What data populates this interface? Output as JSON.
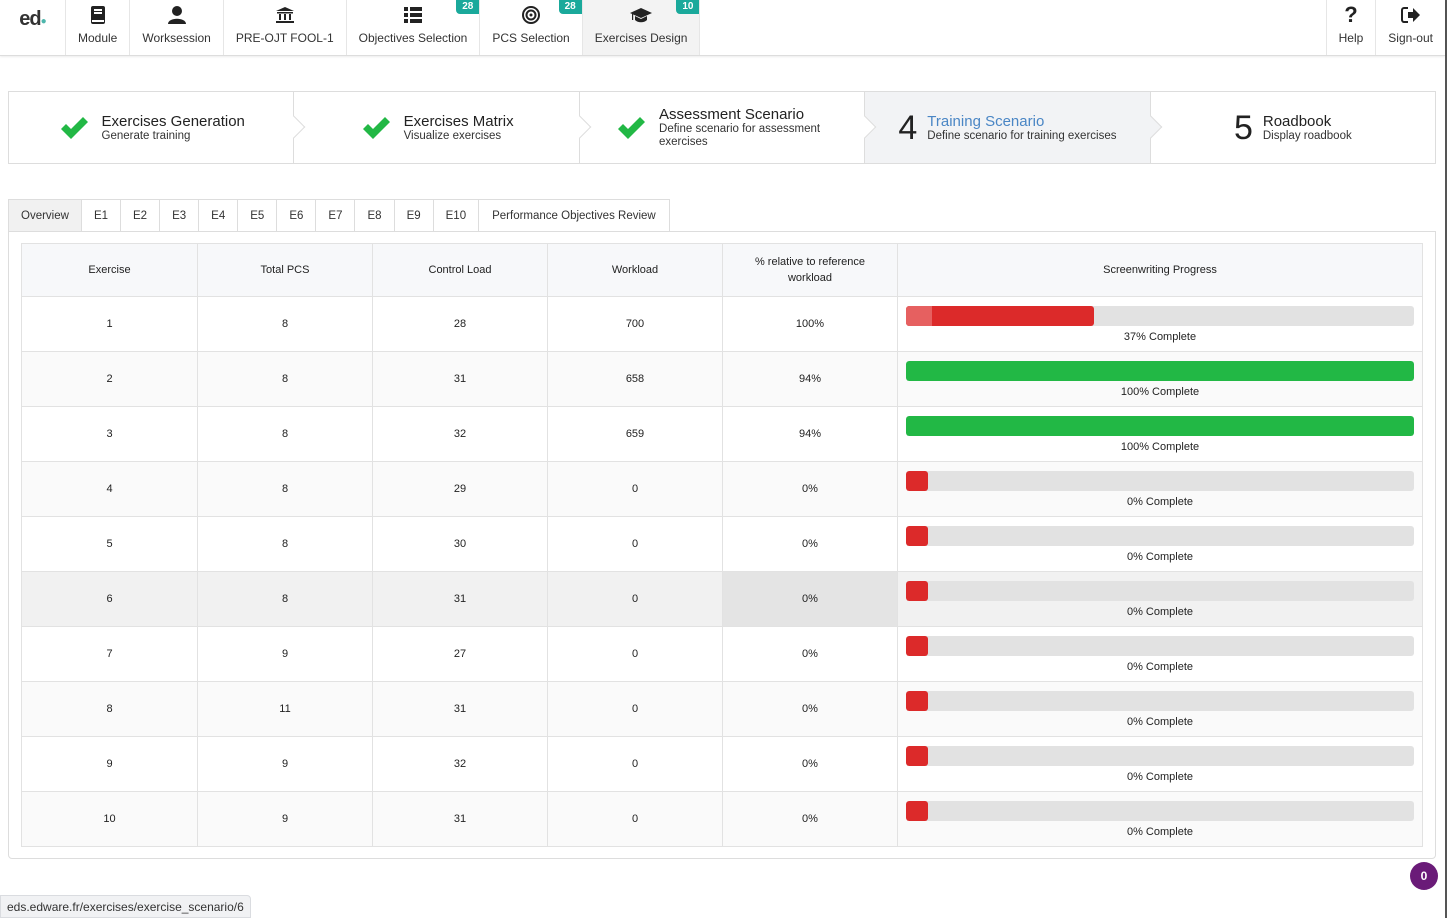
{
  "nav": {
    "logo": "ed",
    "items": [
      {
        "label": "Module",
        "icon": "book-icon"
      },
      {
        "label": "Worksession",
        "icon": "user-icon"
      },
      {
        "label": "PRE-OJT FOOL-1",
        "icon": "institution-icon"
      },
      {
        "label": "Objectives Selection",
        "icon": "list-icon",
        "badge": "28"
      },
      {
        "label": "PCS Selection",
        "icon": "target-icon",
        "badge": "28"
      },
      {
        "label": "Exercises Design",
        "icon": "graduation-cap-icon",
        "badge": "10",
        "active": true
      }
    ],
    "right": [
      {
        "label": "Help",
        "icon": "question-icon"
      },
      {
        "label": "Sign-out",
        "icon": "sign-out-icon"
      }
    ]
  },
  "steps": [
    {
      "title": "Exercises Generation",
      "desc": "Generate training",
      "done": true
    },
    {
      "title": "Exercises Matrix",
      "desc": "Visualize exercises",
      "done": true
    },
    {
      "title": "Assessment Scenario",
      "desc": "Define scenario for assessment exercises",
      "done": true
    },
    {
      "number": "4",
      "title": "Training Scenario",
      "desc": "Define scenario for training exercises",
      "current": true
    },
    {
      "number": "5",
      "title": "Roadbook",
      "desc": "Display roadbook"
    }
  ],
  "tabs": [
    "Overview",
    "E1",
    "E2",
    "E3",
    "E4",
    "E5",
    "E6",
    "E7",
    "E8",
    "E9",
    "E10",
    "Performance Objectives Review"
  ],
  "active_tab": "Overview",
  "table": {
    "headers": [
      "Exercise",
      "Total PCS",
      "Control Load",
      "Workload",
      "% relative to reference workload",
      "Screenwriting Progress"
    ],
    "rows": [
      {
        "exercise": "1",
        "total_pcs": "8",
        "control_load": "28",
        "workload": "700",
        "relative": "100%",
        "progress": 37,
        "progress_label": "37% Complete"
      },
      {
        "exercise": "2",
        "total_pcs": "8",
        "control_load": "31",
        "workload": "658",
        "relative": "94%",
        "progress": 100,
        "progress_label": "100% Complete"
      },
      {
        "exercise": "3",
        "total_pcs": "8",
        "control_load": "32",
        "workload": "659",
        "relative": "94%",
        "progress": 100,
        "progress_label": "100% Complete"
      },
      {
        "exercise": "4",
        "total_pcs": "8",
        "control_load": "29",
        "workload": "0",
        "relative": "0%",
        "progress": 0,
        "progress_label": "0% Complete"
      },
      {
        "exercise": "5",
        "total_pcs": "8",
        "control_load": "30",
        "workload": "0",
        "relative": "0%",
        "progress": 0,
        "progress_label": "0% Complete"
      },
      {
        "exercise": "6",
        "total_pcs": "8",
        "control_load": "31",
        "workload": "0",
        "relative": "0%",
        "progress": 0,
        "progress_label": "0% Complete"
      },
      {
        "exercise": "7",
        "total_pcs": "9",
        "control_load": "27",
        "workload": "0",
        "relative": "0%",
        "progress": 0,
        "progress_label": "0% Complete"
      },
      {
        "exercise": "8",
        "total_pcs": "11",
        "control_load": "31",
        "workload": "0",
        "relative": "0%",
        "progress": 0,
        "progress_label": "0% Complete"
      },
      {
        "exercise": "9",
        "total_pcs": "9",
        "control_load": "32",
        "workload": "0",
        "relative": "0%",
        "progress": 0,
        "progress_label": "0% Complete"
      },
      {
        "exercise": "10",
        "total_pcs": "9",
        "control_load": "31",
        "workload": "0",
        "relative": "0%",
        "progress": 0,
        "progress_label": "0% Complete"
      }
    ]
  },
  "colors": {
    "success": "#22b845",
    "danger": "#dc2a2a",
    "accent": "#4a86c5",
    "badge": "#1aa99b",
    "chat": "#6a1b78"
  },
  "status_url": "eds.edware.fr/exercises/exercise_scenario/6",
  "chat_count": "0"
}
